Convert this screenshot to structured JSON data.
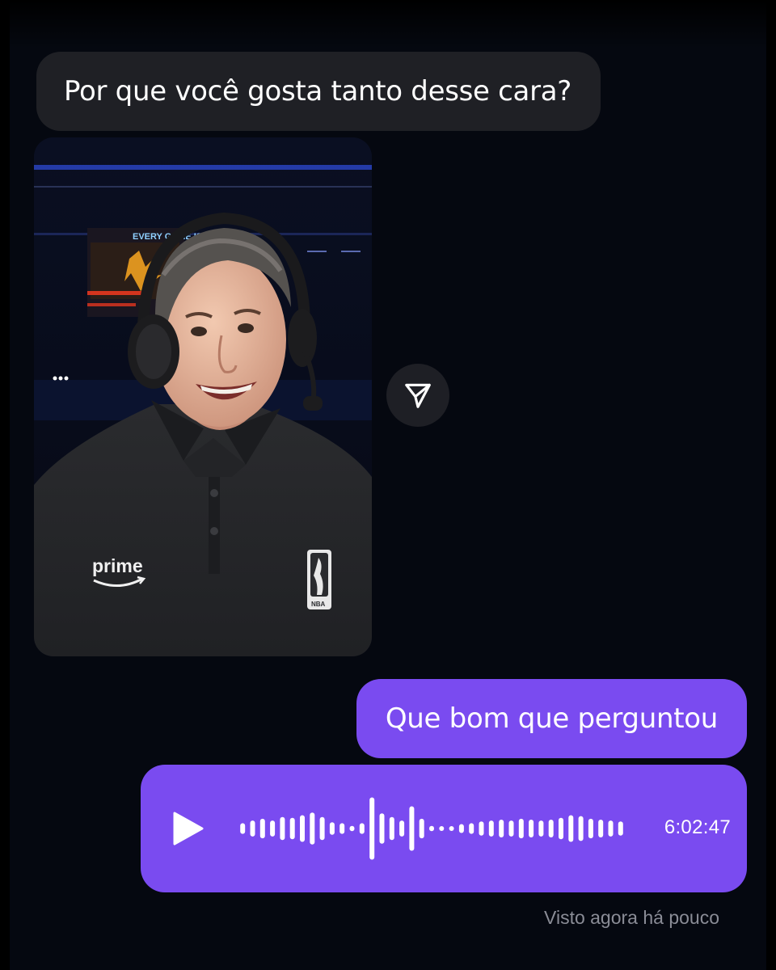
{
  "conversation": {
    "incoming_message": "Por que você gosta tanto desse cara?",
    "photo": {
      "scoreboard_text": "EVERY GAME IS A",
      "shirt_logo_text": "prime",
      "badge_text": "NBA"
    },
    "outgoing_message": "Que bom que perguntou",
    "voice_message": {
      "duration": "6:02:47",
      "waveform_levels": [
        0.12,
        0.18,
        0.22,
        0.18,
        0.26,
        0.24,
        0.3,
        0.36,
        0.26,
        0.14,
        0.12,
        0.06,
        0.12,
        0.7,
        0.34,
        0.26,
        0.18,
        0.5,
        0.22,
        0.06,
        0.05,
        0.05,
        0.1,
        0.12,
        0.16,
        0.18,
        0.2,
        0.18,
        0.22,
        0.2,
        0.18,
        0.2,
        0.24,
        0.3,
        0.28,
        0.22,
        0.2,
        0.18,
        0.16
      ]
    },
    "seen_status": "Visto agora há pouco"
  },
  "colors": {
    "background": "#050810",
    "incoming_bubble": "#1f2025",
    "outgoing_bubble": "#7a4bf0",
    "seen_text": "#8a8c96"
  },
  "icons": {
    "share": "paper-plane-icon",
    "play": "play-icon"
  }
}
